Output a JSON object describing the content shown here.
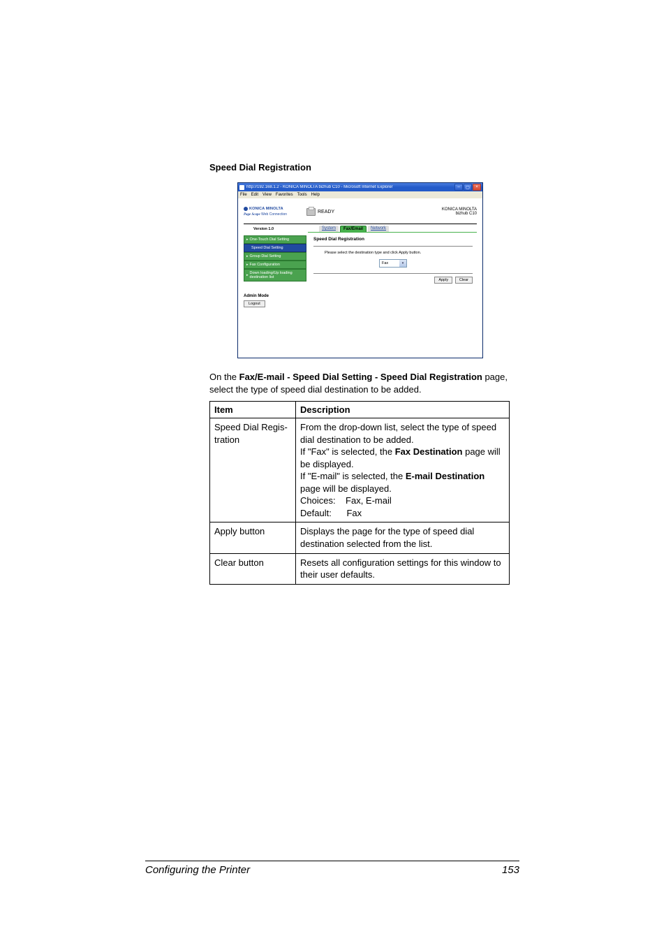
{
  "section_title": "Speed Dial Registration",
  "browser": {
    "title": "http://192.168.1.2 - KONICA MINOLTA bizhub C10 - Microsoft Internet Explorer",
    "menus": [
      "File",
      "Edit",
      "View",
      "Favorites",
      "Tools",
      "Help"
    ],
    "logo_text": "KONICA MINOLTA",
    "web_connection_prefix": "Page Scope",
    "web_connection": "Web Connection",
    "version": "Version 1.0",
    "ready": "READY",
    "model_line1": "KONICA MINOLTA",
    "model_line2": "bizhub C10",
    "tabs": {
      "system": "System",
      "fax": "Fax/Email",
      "network": "Network"
    },
    "sidebar": {
      "one_touch": "One-Touch Dial Setting",
      "speed_dial": "Speed Dial Setting",
      "group_dial": "Group Dial Setting",
      "fax_config": "Fax Configuration",
      "downup": "Down loading/Up loading destination list"
    },
    "admin_mode": "Admin Mode",
    "logout": "Logout",
    "main": {
      "title": "Speed Dial Registration",
      "instruction": "Please select the destination type and click Apply button.",
      "select_value": "Fax",
      "apply": "Apply",
      "clear": "Clear"
    }
  },
  "intro": {
    "prefix": "On the ",
    "bold_path": "Fax/E-mail - Speed Dial Setting - Speed Dial Registration",
    "suffix": " page, select the type of speed dial destination to be added."
  },
  "table": {
    "head_item": "Item",
    "head_desc": "Description",
    "row1": {
      "item": "Speed Dial Regis­tration",
      "line1": "From the drop-down list, select the type of speed dial destination to be added.",
      "line2a": "If \"Fax\" is selected, the ",
      "line2b": "Fax Destination",
      "line2c": " page will be displayed.",
      "line3a": "If \"E-mail\" is selected, the ",
      "line3b": "E-mail Destination",
      "line3c": " page will be displayed.",
      "choices_label": "Choices:",
      "choices_value": "Fax, E-mail",
      "default_label": "Default:",
      "default_value": "Fax"
    },
    "row2": {
      "item": "Apply button",
      "desc": "Displays the page for the type of speed dial destination selected from the list."
    },
    "row3": {
      "item": "Clear button",
      "desc": "Resets all configuration settings for this window to their user defaults."
    }
  },
  "footer": {
    "title": "Configuring the Printer",
    "page": "153"
  }
}
